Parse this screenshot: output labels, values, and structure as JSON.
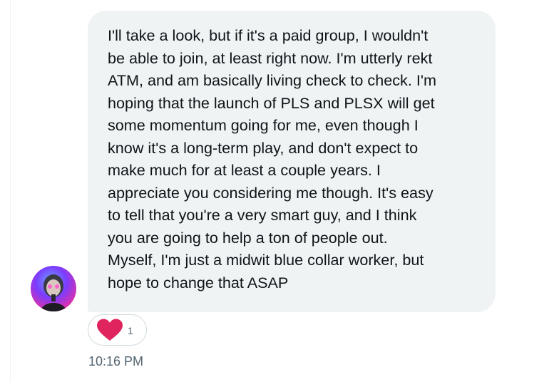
{
  "message": {
    "text": "I'll take a look, but if it's a paid group, I wouldn't\nbe able to join, at least right now. I'm utterly rekt\nATM, and am basically living check to check. I'm\nhoping that the launch of PLS and PLSX will get\nsome momentum going for me, even though I\nknow it's a long-term play, and don't expect to\nmake much for at least a couple years. I\nappreciate you considering me though. It's easy\nto tell that you're a very smart guy, and I think\nyou are going to help a ton of people out.\nMyself, I'm just a midwit blue collar worker, but\nhope to change that ASAP",
    "timestamp": "10:16 PM"
  },
  "reaction": {
    "icon": "heart-icon",
    "count": "1",
    "color": "#e0245e"
  },
  "colors": {
    "bubble": "#eff3f4",
    "text": "#0f1419",
    "muted": "#536471"
  }
}
